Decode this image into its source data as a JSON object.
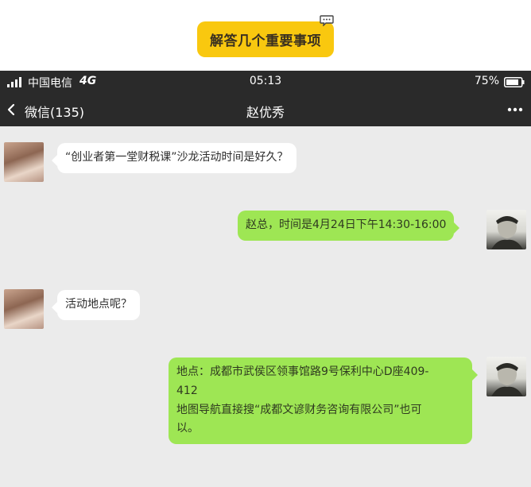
{
  "banner": {
    "title": "解答几个重要事项"
  },
  "statusbar": {
    "carrier": "中国电信",
    "network": "4G",
    "time": "05:13",
    "battery": "75%"
  },
  "navbar": {
    "back_label": "微信(135)",
    "title": "赵优秀"
  },
  "messages": [
    {
      "side": "received",
      "text": "“创业者第一堂财税课”沙龙活动时间是好久？"
    },
    {
      "side": "sent",
      "text": "赵总，时间是4月24日下午14:30-16:00"
    },
    {
      "side": "received",
      "text": "活动地点呢？"
    },
    {
      "side": "sent",
      "lines": [
        "地点：成都市武侯区领事馆路9号保利中心D座409-",
        "412",
        "地图导航直接搜“成都文谚财务咨询有限公司”也可",
        "以。"
      ]
    }
  ],
  "colors": {
    "banner_accent": "#f9c80f",
    "header_bg": "#2a2a2a",
    "chat_bg": "#ebebeb",
    "sent_bubble": "#9ee654",
    "received_bubble": "#ffffff"
  }
}
